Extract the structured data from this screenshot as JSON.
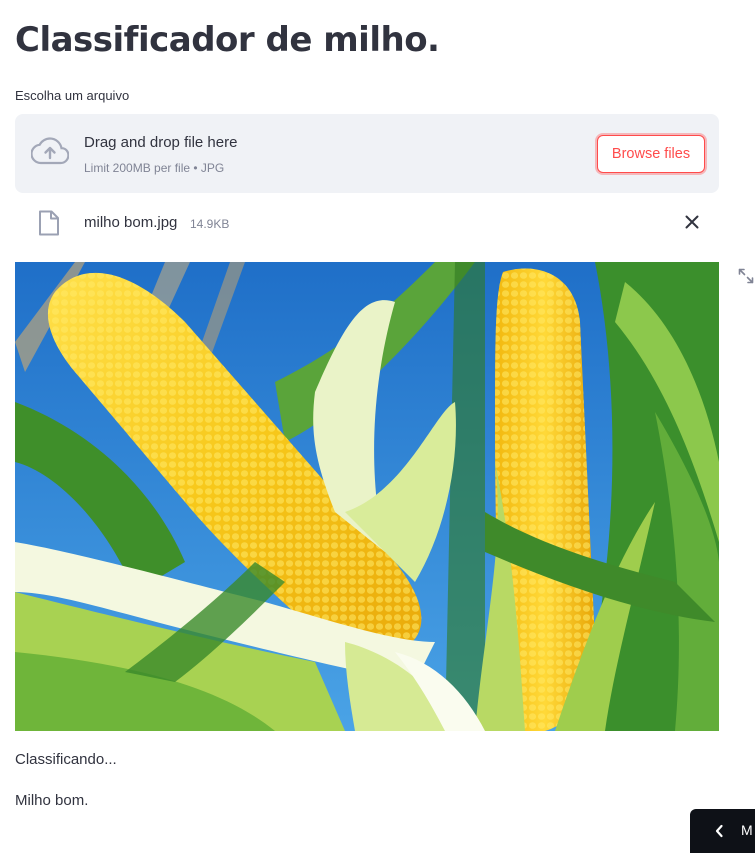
{
  "page": {
    "title": "Classificador de milho."
  },
  "uploader": {
    "label": "Escolha um arquivo",
    "drop_text": "Drag and drop file here",
    "limit_text": "Limit 200MB per file • JPG",
    "browse_label": "Browse files",
    "icon": "cloud-upload-icon"
  },
  "uploaded_file": {
    "name": "milho bom.jpg",
    "size": "14.9KB",
    "icon": "file-icon",
    "remove_icon": "close-icon"
  },
  "image": {
    "subject": "two ears of yellow corn",
    "fullscreen_icon": "fullscreen-icon"
  },
  "output": {
    "status": "Classificando...",
    "result": "Milho bom."
  },
  "manage_app": {
    "label": "M",
    "icon": "chevron-left-icon"
  },
  "colors": {
    "accent": "#ff4b4b",
    "text": "#31333f",
    "muted": "#808495",
    "dropzone_bg": "#f0f2f6",
    "dark_button": "#0e1117"
  }
}
